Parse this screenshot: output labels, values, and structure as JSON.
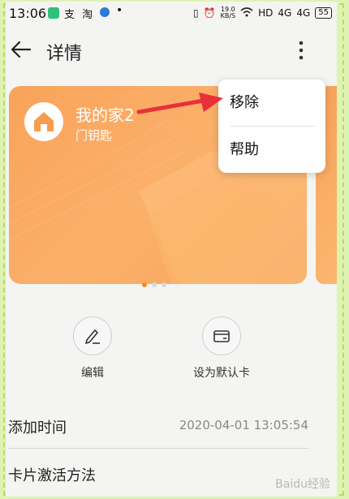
{
  "status_bar": {
    "time": "13:06",
    "app2": "支",
    "app3": "淘",
    "network_speed": "19.0",
    "network_speed_unit": "KB/S",
    "hd_label": "HD",
    "signal1": "4G",
    "signal2": "4G",
    "battery": "55"
  },
  "header": {
    "title": "详情"
  },
  "card": {
    "name": "我的家2",
    "subtitle": "门钥匙",
    "color": "#f9a35a"
  },
  "pager": {
    "count": 3,
    "active": 0
  },
  "actions": [
    {
      "label": "编辑"
    },
    {
      "label": "设为默认卡"
    }
  ],
  "info": {
    "added_time_label": "添加时间",
    "added_time_value": "2020-04-01 13:05:54",
    "activation_label": "卡片激活方法"
  },
  "menu": {
    "items": [
      "移除",
      "帮助"
    ]
  },
  "annotation_color": "#e8303a",
  "watermark": "Baidu经验"
}
